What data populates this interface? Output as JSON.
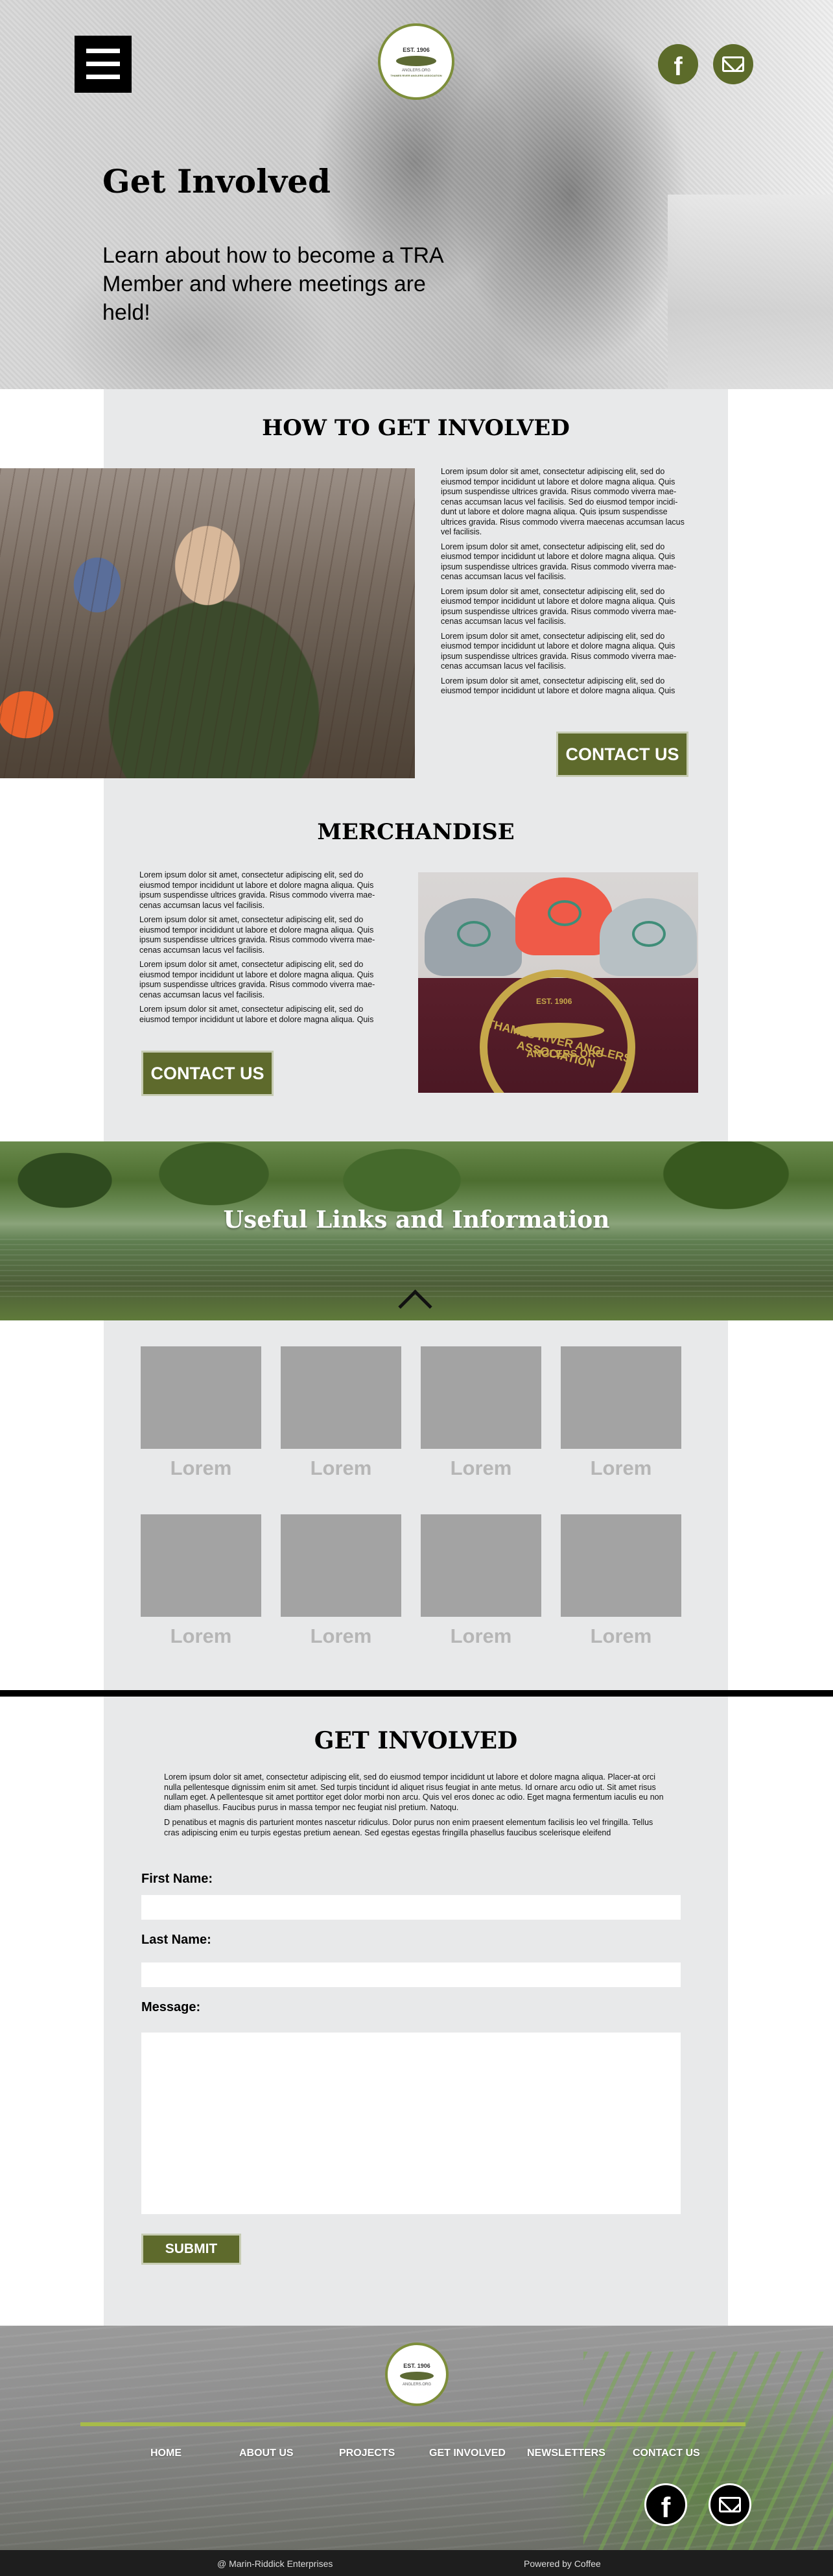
{
  "hero": {
    "title": "Get Involved",
    "subtitle": "Learn about how to become a TRA Member and where meetings are held!",
    "logo_est": "EST. 1906",
    "logo_org": "ANGLERS.ORG",
    "logo_ring": "THAMES RIVER ANGLERS ASSOCIATION"
  },
  "how": {
    "title": "HOW TO GET INVOLVED",
    "paragraphs": [
      "Lorem ipsum dolor sit amet, consectetur adipiscing elit, sed do eiusmod tempor incididunt ut labore et dolore magna aliqua. Quis ipsum suspendisse ultrices gravida. Risus commodo viverra mae-cenas accumsan lacus vel facilisis. Sed do eiusmod tempor incidi-dunt ut labore et dolore magna aliqua. Quis ipsum suspendisse ultrices gravida. Risus commodo viverra maecenas accumsan lacus vel facilisis.",
      "Lorem ipsum dolor sit amet, consectetur adipiscing elit, sed do eiusmod tempor incididunt ut labore et dolore magna aliqua. Quis ipsum suspendisse ultrices gravida. Risus commodo viverra mae-cenas accumsan lacus vel facilisis.",
      "Lorem ipsum dolor sit amet, consectetur adipiscing elit, sed do eiusmod tempor incididunt ut labore et dolore magna aliqua. Quis ipsum suspendisse ultrices gravida. Risus commodo viverra mae-cenas accumsan lacus vel facilisis.",
      "Lorem ipsum dolor sit amet, consectetur adipiscing elit, sed do eiusmod tempor incididunt ut labore et dolore magna aliqua. Quis ipsum suspendisse ultrices gravida. Risus commodo viverra mae-cenas accumsan lacus vel facilisis.",
      "Lorem ipsum dolor sit amet, consectetur adipiscing elit, sed do eiusmod tempor incididunt ut labore et dolore magna aliqua. Quis"
    ],
    "contact_label": "CONTACT US"
  },
  "merch": {
    "title": "MERCHANDISE",
    "paragraphs": [
      "Lorem ipsum dolor sit amet, consectetur adipiscing elit, sed do eiusmod tempor incididunt ut labore et dolore magna aliqua. Quis ipsum suspendisse ultrices gravida. Risus commodo viverra mae-cenas accumsan lacus vel facilisis.",
      "Lorem ipsum dolor sit amet, consectetur adipiscing elit, sed do eiusmod tempor incididunt ut labore et dolore magna aliqua. Quis ipsum suspendisse ultrices gravida. Risus commodo viverra mae-cenas accumsan lacus vel facilisis.",
      "Lorem ipsum dolor sit amet, consectetur adipiscing elit, sed do eiusmod tempor incididunt ut labore et dolore magna aliqua. Quis ipsum suspendisse ultrices gravida. Risus commodo viverra mae-cenas accumsan lacus vel facilisis.",
      "Lorem ipsum dolor sit amet, consectetur adipiscing elit, sed do eiusmod tempor incididunt ut labore et dolore magna aliqua. Quis"
    ],
    "contact_label": "CONTACT US",
    "shirt_est": "EST. 1906",
    "shirt_url": "ANGLERS.ORG",
    "shirt_arc": "THAMES RIVER ANGLERS ASSOCIATION"
  },
  "links": {
    "title": "Useful Links and Information",
    "tiles": [
      "Lorem",
      "Lorem",
      "Lorem",
      "Lorem",
      "Lorem",
      "Lorem",
      "Lorem",
      "Lorem"
    ]
  },
  "form": {
    "title": "GET INVOLVED",
    "intro_1": "Lorem ipsum dolor sit amet, consectetur adipiscing elit, sed do eiusmod tempor incididunt ut labore et dolore magna aliqua. Placer-at orci nulla pellentesque dignissim enim sit amet. Sed turpis tincidunt id aliquet risus feugiat in ante metus. Id ornare arcu odio ut. Sit amet risus nullam eget. A pellentesque sit amet porttitor eget dolor morbi non arcu. Quis vel eros donec ac odio. Eget magna fermentum iaculis eu non diam phasellus. Faucibus purus in massa tempor nec feugiat nisl pretium. Natoqu.",
    "intro_2": "D penatibus et magnis dis parturient montes nascetur ridiculus. Dolor purus non enim praesent elementum facilisis leo vel fringilla. Tellus cras adipiscing enim eu turpis egestas pretium aenean. Sed egestas egestas fringilla phasellus faucibus scelerisque eleifend",
    "first_name_label": "First Name:",
    "first_name_value": "",
    "last_name_label": "Last Name:",
    "last_name_value": "",
    "message_label": "Message:",
    "message_value": "",
    "submit_label": "SUBMIT"
  },
  "footer": {
    "logo_est": "EST. 1906",
    "logo_org": "ANGLERS.ORG",
    "nav": [
      "HOME",
      "ABOUT US",
      "PROJECTS",
      "GET INVOLVED",
      "NEWSLETTERS",
      "CONTACT US"
    ],
    "copyright": "@ Marin-Riddick Enterprises",
    "powered": "Powered by Coffee"
  },
  "icons": {
    "menu": "hamburger-menu-icon",
    "facebook": "facebook-icon",
    "email": "envelope-icon",
    "up": "chevron-up-icon"
  },
  "colors": {
    "accent": "#5e6a2c",
    "accent_light": "#a7bb4a",
    "panel": "#e8e9ea",
    "tile": "#a3a3a3",
    "tile_label": "#b6b6b6"
  }
}
